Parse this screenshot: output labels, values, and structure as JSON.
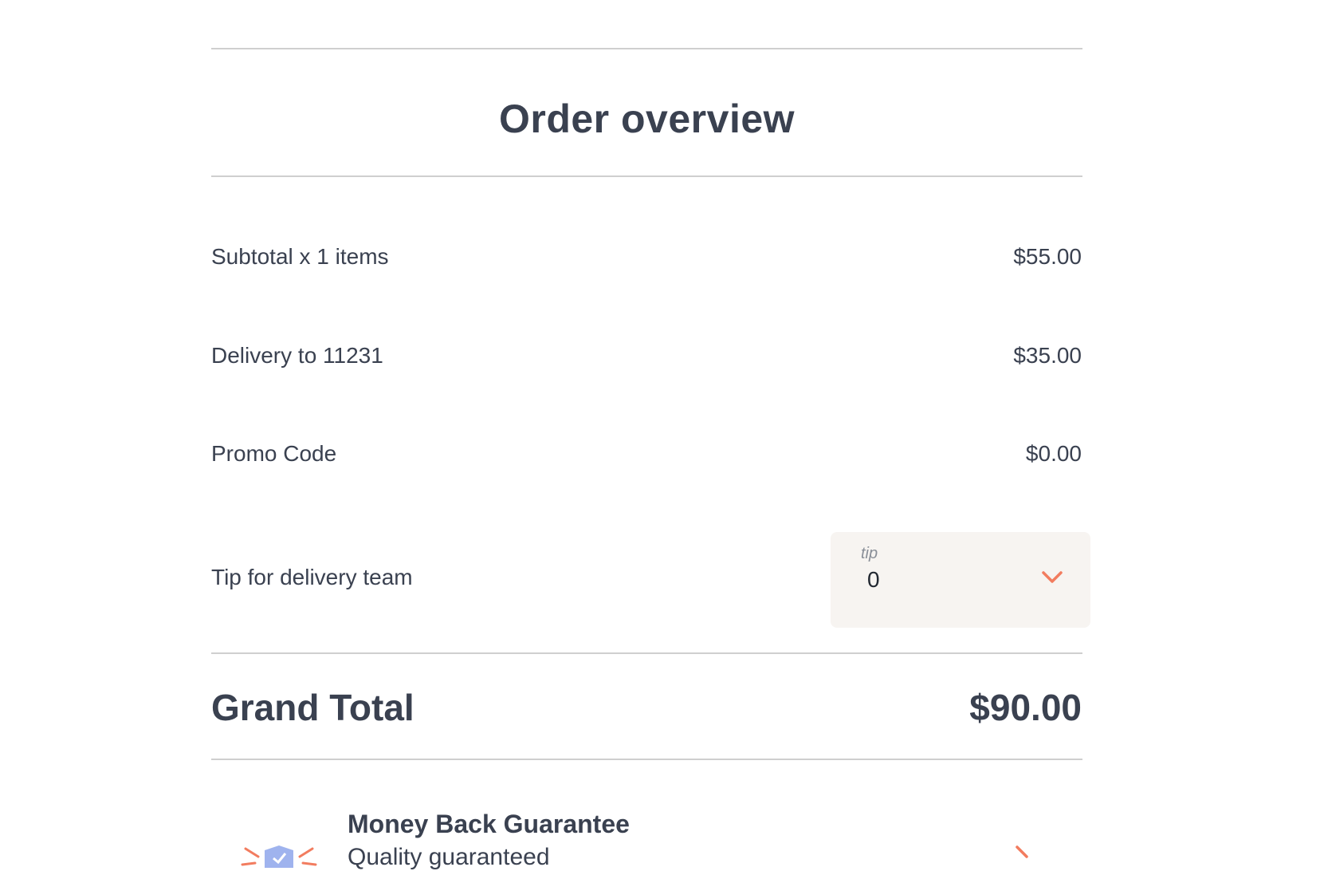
{
  "header": {
    "title": "Order overview"
  },
  "summary": {
    "rows": [
      {
        "label": "Subtotal x 1 items",
        "value": "$55.00"
      },
      {
        "label": "Delivery to 11231",
        "value": "$35.00"
      },
      {
        "label": "Promo Code",
        "value": "$0.00"
      }
    ],
    "tip": {
      "label": "Tip for delivery team",
      "caption": "tip",
      "value": "0"
    }
  },
  "total": {
    "label": "Grand Total",
    "value": "$90.00"
  },
  "guarantee": {
    "title": "Money Back Guarantee",
    "subtitle": "Quality guaranteed"
  },
  "colors": {
    "text": "#3a4150",
    "accent": "#f27c5f",
    "shield": "#9fb3ee",
    "tip_bg": "#f7f4f1",
    "divider": "#cfcfcf"
  },
  "icons": {
    "tip_dropdown": "chevron-down-icon",
    "guarantee": "shield-check-icon",
    "guarantee_expand": "chevron-right-icon"
  }
}
